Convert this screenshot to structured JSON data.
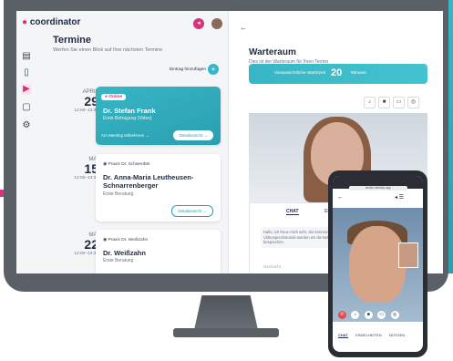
{
  "app": {
    "logo": "coordinator"
  },
  "left": {
    "title": "Termine",
    "subtitle": "Werfen Sie einen Blick auf Ihre nächsten Termine",
    "add_label": "Eintrag hinzufügen",
    "appointments": [
      {
        "month": "APRIL",
        "day": "29",
        "time": "12:00–13:30",
        "badge": "Online",
        "doctor": "Dr. Stefan Frank",
        "kind": "Erste Befragung (Video)",
        "join": "Am Meeting teilnehmen →",
        "detail": "Detailansicht →"
      },
      {
        "month": "MAI",
        "day": "15",
        "time": "12:00–13:30",
        "place": "Praxis Dr. Schwerdtel",
        "doctor": "Dr. Anna-Maria Leutheusen-Schnarrenberger",
        "kind": "Erste Beratung",
        "detail": "Detailansicht →"
      },
      {
        "month": "MAI",
        "day": "22",
        "time": "12:00–13:30",
        "place": "Praxis Dr. Weißzahn",
        "doctor": "Dr. Weißzahn",
        "kind": "Erste Beratung"
      }
    ]
  },
  "right": {
    "title": "Warteraum",
    "subtitle": "Dies ist der Warteraum für Ihren Termin",
    "wait_label": "Voraussichtliche Wartezeit",
    "wait_value": "20",
    "wait_unit": "Minuten",
    "chat_tab": "CHAT",
    "other_tab": "EINZ",
    "message": "Hallo, ich freue mich sehr, Sie kennenzulernen. Videosprechstunde werden wir die Behandlung besprechen.",
    "input_placeholder": "Nachricht ..."
  },
  "phone": {
    "url": "termin.meindoc.app",
    "tabs": [
      "CHAT",
      "EINZELHEITEN",
      "NOTIZEN"
    ]
  },
  "colors": {
    "accent": "#37b6c5",
    "brand": "#d8327a"
  }
}
